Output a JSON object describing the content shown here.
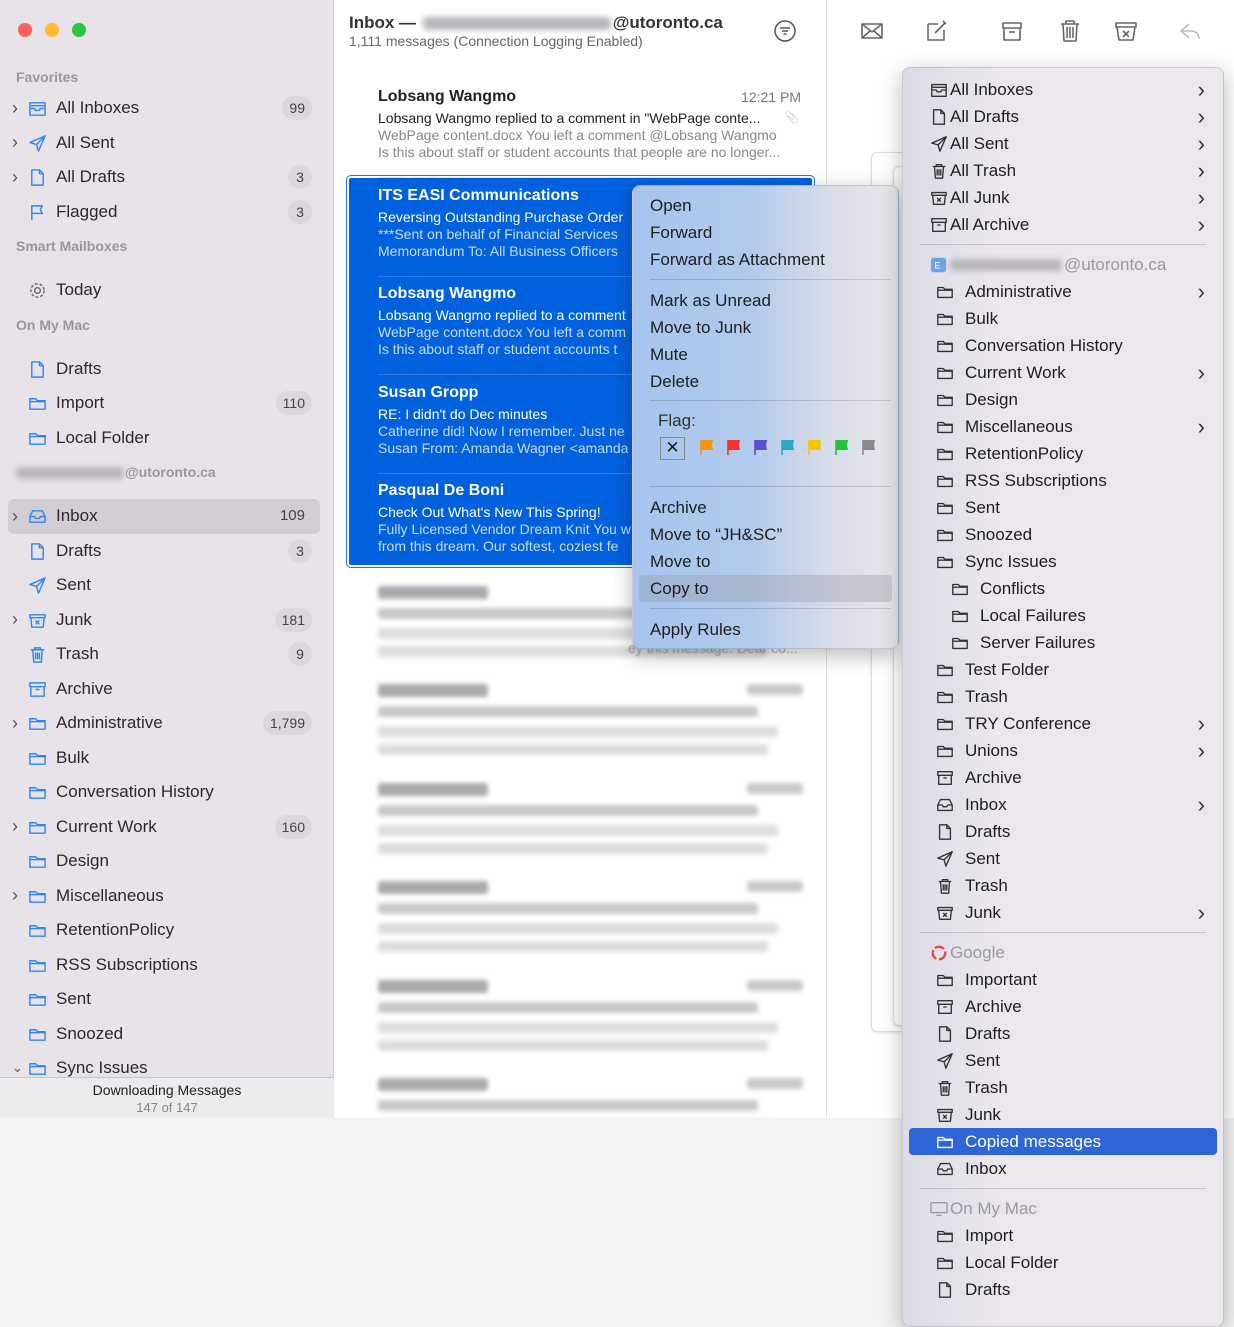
{
  "window": {
    "traffic_lights": [
      "#fe5f57",
      "#febc2e",
      "#28c840"
    ]
  },
  "sidebar": {
    "sections": [
      {
        "header": "Favorites",
        "items": [
          {
            "label": "All Inboxes",
            "icon": "inbox-stack",
            "count": "99",
            "chevron": "right"
          },
          {
            "label": "All Sent",
            "icon": "send",
            "chevron": "right"
          },
          {
            "label": "All Drafts",
            "icon": "doc",
            "count": "3",
            "chevron": "right"
          },
          {
            "label": "Flagged",
            "icon": "flag",
            "count": "3"
          }
        ]
      },
      {
        "header": "Smart Mailboxes",
        "items": [
          {
            "label": "Today",
            "icon": "gear",
            "gray": true
          }
        ]
      },
      {
        "header": "On My Mac",
        "items": [
          {
            "label": "Drafts",
            "icon": "doc"
          },
          {
            "label": "Import",
            "icon": "folder",
            "count": "110"
          },
          {
            "label": "Local Folder",
            "icon": "folder"
          }
        ]
      },
      {
        "header": "@utoronto.ca",
        "blurred_prefix": true,
        "items": [
          {
            "label": "Inbox",
            "icon": "inbox",
            "count": "109",
            "chevron": "right",
            "selected": true
          },
          {
            "label": "Drafts",
            "icon": "doc",
            "count": "3"
          },
          {
            "label": "Sent",
            "icon": "send"
          },
          {
            "label": "Junk",
            "icon": "junk",
            "count": "181",
            "chevron": "right"
          },
          {
            "label": "Trash",
            "icon": "trash",
            "count": "9"
          },
          {
            "label": "Archive",
            "icon": "archive"
          },
          {
            "label": "Administrative",
            "icon": "folder",
            "count": "1,799",
            "chevron": "right"
          },
          {
            "label": "Bulk",
            "icon": "folder"
          },
          {
            "label": "Conversation History",
            "icon": "folder"
          },
          {
            "label": "Current Work",
            "icon": "folder",
            "count": "160",
            "chevron": "right"
          },
          {
            "label": "Design",
            "icon": "folder"
          },
          {
            "label": "Miscellaneous",
            "icon": "folder",
            "chevron": "right"
          },
          {
            "label": "RetentionPolicy",
            "icon": "folder"
          },
          {
            "label": "RSS Subscriptions",
            "icon": "folder"
          },
          {
            "label": "Sent",
            "icon": "folder"
          },
          {
            "label": "Snoozed",
            "icon": "folder"
          },
          {
            "label": "Sync Issues",
            "icon": "folder",
            "chevron": "down"
          }
        ]
      }
    ],
    "status": {
      "title": "Downloading Messages",
      "progress": "147 of 147"
    }
  },
  "message_list": {
    "title_prefix": "Inbox —",
    "title_suffix": "@utoronto.ca",
    "subtitle": "1,111 messages (Connection Logging Enabled)",
    "messages": [
      {
        "from": "Lobsang Wangmo",
        "time": "12:21 PM",
        "subject": "Lobsang Wangmo replied to a comment in \"WebPage conte...",
        "preview1": "WebPage content.docx You left a comment @Lobsang Wangmo",
        "preview2": "Is this about staff or student accounts that people are no longer...",
        "attachment": true
      },
      {
        "from": "ITS EASI Communications",
        "subject": "Reversing Outstanding Purchase Order",
        "preview1": "***Sent on behalf of Financial Services",
        "preview2": "Memorandum To: All Business Officers",
        "selected": true
      },
      {
        "from": "Lobsang Wangmo",
        "subject": "Lobsang Wangmo replied to a comment",
        "preview1": "WebPage content.docx You left a comm",
        "preview2": "Is this about staff or student accounts t",
        "selected": true
      },
      {
        "from": "Susan Gropp",
        "subject": "RE: I didn't do Dec minutes",
        "preview1": "Catherine did! Now I remember. Just ne",
        "preview2": "Susan From: Amanda Wagner <amanda",
        "selected": true
      },
      {
        "from": "Pasqual De Boni",
        "subject": "Check Out What's New This Spring!",
        "preview1": "Fully Licensed Vendor Dream Knit You w",
        "preview2": "from this dream. Our softest, coziest fe",
        "selected": true
      }
    ],
    "blurred_fragment": "ey this message. Dear co..."
  },
  "toolbar": {
    "icons": [
      "envelope-icon",
      "compose-icon",
      "archive-icon",
      "trash-icon",
      "junk-icon",
      "reply-icon"
    ]
  },
  "context_menu": {
    "items": [
      "Open",
      "Forward",
      "Forward as Attachment",
      "Mark as Unread",
      "Move to Junk",
      "Mute",
      "Delete"
    ],
    "flag_label": "Flag:",
    "clear_flag": "✕",
    "flag_colors": [
      "#f7930e",
      "#f2352c",
      "#5b4fd0",
      "#2ba8c3",
      "#f6c500",
      "#25c03d",
      "#8a8a8c"
    ],
    "items2": [
      "Archive",
      "Move to “JH&SC”",
      "Move to",
      "Copy to"
    ],
    "items3": [
      "Apply Rules"
    ],
    "highlighted": "Copy to"
  },
  "copy_submenu": {
    "items": [
      {
        "label": "All Inboxes",
        "icon": "inbox-stack",
        "arrow": true
      },
      {
        "label": "All Drafts",
        "icon": "doc",
        "arrow": true
      },
      {
        "label": "All Sent",
        "icon": "send",
        "arrow": true
      },
      {
        "label": "All Trash",
        "icon": "trash",
        "arrow": true
      },
      {
        "label": "All Junk",
        "icon": "junk",
        "arrow": true
      },
      {
        "label": "All Archive",
        "icon": "archive",
        "arrow": true
      },
      {
        "sep": true
      },
      {
        "label": "@utoronto.ca",
        "icon": "exchange",
        "header": true,
        "blurred_prefix": true
      },
      {
        "label": "Administrative",
        "icon": "folder",
        "level": 1,
        "arrow": true
      },
      {
        "label": "Bulk",
        "icon": "folder",
        "level": 1
      },
      {
        "label": "Conversation History",
        "icon": "folder",
        "level": 1
      },
      {
        "label": "Current Work",
        "icon": "folder",
        "level": 1,
        "arrow": true
      },
      {
        "label": "Design",
        "icon": "folder",
        "level": 1
      },
      {
        "label": "Miscellaneous",
        "icon": "folder",
        "level": 1,
        "arrow": true
      },
      {
        "label": "RetentionPolicy",
        "icon": "folder",
        "level": 1
      },
      {
        "label": "RSS Subscriptions",
        "icon": "folder",
        "level": 1
      },
      {
        "label": "Sent",
        "icon": "folder",
        "level": 1
      },
      {
        "label": "Snoozed",
        "icon": "folder",
        "level": 1
      },
      {
        "label": "Sync Issues",
        "icon": "folder",
        "level": 1
      },
      {
        "label": "Conflicts",
        "icon": "folder",
        "level": 2
      },
      {
        "label": "Local Failures",
        "icon": "folder",
        "level": 2
      },
      {
        "label": "Server Failures",
        "icon": "folder",
        "level": 2
      },
      {
        "label": "Test Folder",
        "icon": "folder",
        "level": 1
      },
      {
        "label": "Trash",
        "icon": "folder",
        "level": 1
      },
      {
        "label": "TRY Conference",
        "icon": "folder",
        "level": 1,
        "arrow": true
      },
      {
        "label": "Unions",
        "icon": "folder",
        "level": 1,
        "arrow": true
      },
      {
        "label": "Archive",
        "icon": "archive",
        "level": 1
      },
      {
        "label": "Inbox",
        "icon": "inbox",
        "level": 1,
        "arrow": true
      },
      {
        "label": "Drafts",
        "icon": "doc",
        "level": 1
      },
      {
        "label": "Sent",
        "icon": "send",
        "level": 1
      },
      {
        "label": "Trash",
        "icon": "trash",
        "level": 1
      },
      {
        "label": "Junk",
        "icon": "junk",
        "level": 1,
        "arrow": true
      },
      {
        "sep": true
      },
      {
        "label": "Google",
        "icon": "google",
        "header": true
      },
      {
        "label": "Important",
        "icon": "folder",
        "level": 1
      },
      {
        "label": "Archive",
        "icon": "archive",
        "level": 1
      },
      {
        "label": "Drafts",
        "icon": "doc",
        "level": 1
      },
      {
        "label": "Sent",
        "icon": "send",
        "level": 1
      },
      {
        "label": "Trash",
        "icon": "trash",
        "level": 1
      },
      {
        "label": "Junk",
        "icon": "junk",
        "level": 1
      },
      {
        "label": "Copied messages",
        "icon": "folder",
        "level": 1,
        "highlighted": true
      },
      {
        "label": "Inbox",
        "icon": "inbox",
        "level": 1
      },
      {
        "sep": true
      },
      {
        "label": "On My Mac",
        "icon": "computer",
        "header": true
      },
      {
        "label": "Import",
        "icon": "folder",
        "level": 1
      },
      {
        "label": "Local Folder",
        "icon": "folder",
        "level": 1
      },
      {
        "label": "Drafts",
        "icon": "doc",
        "level": 1
      }
    ]
  },
  "colors": {
    "accent": "#0061df",
    "sidebar_icon": "#2f86f5",
    "highlight": "#2f66d7"
  }
}
